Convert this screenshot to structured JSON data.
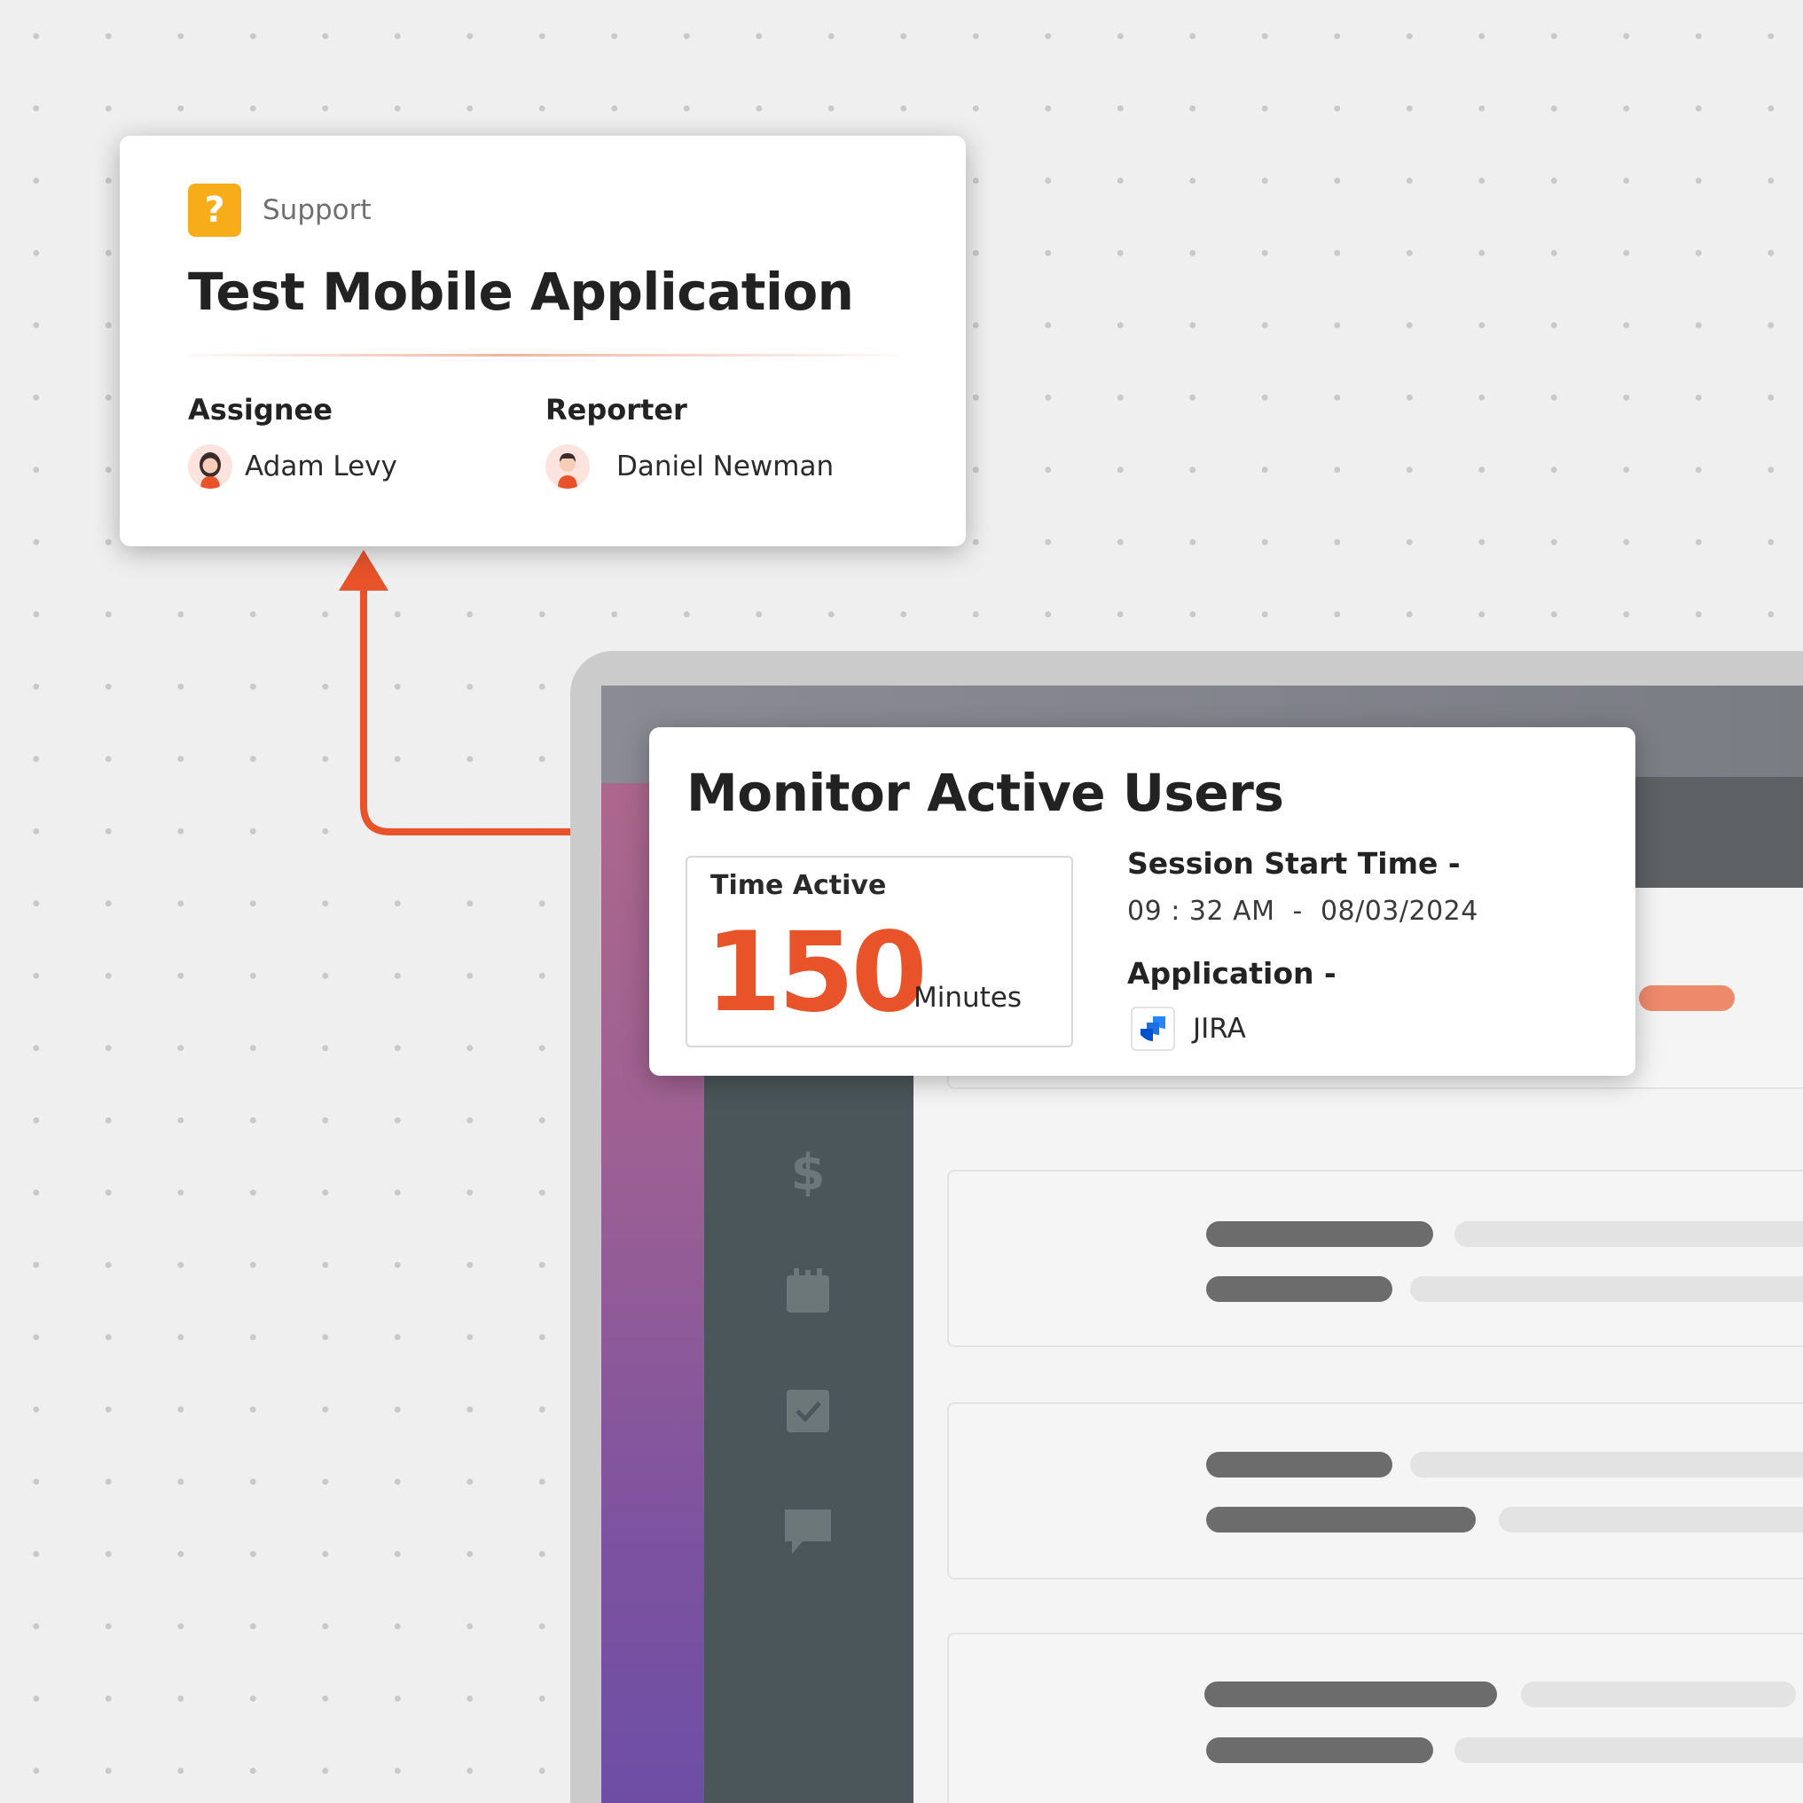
{
  "ticket": {
    "category": "Support",
    "category_icon": "question-icon",
    "title": "Test Mobile Application",
    "assignee_label": "Assignee",
    "assignee_name": "Adam Levy",
    "reporter_label": "Reporter",
    "reporter_name": "Daniel Newman"
  },
  "monitor": {
    "title": "Monitor Active Users",
    "time_active_label": "Time Active",
    "time_active_value": "150",
    "time_active_unit": "Minutes",
    "session_start_label": "Session Start Time -",
    "session_start_value": "09 : 32 AM  -  08/03/2024",
    "application_label": "Application -",
    "application_name": "JIRA"
  },
  "sidebar_icons": [
    "support-icon",
    "user-icon",
    "dollar-icon",
    "calendar-icon",
    "checkbox-icon",
    "chat-icon"
  ],
  "colors": {
    "accent": "#e8532a",
    "support_tag": "#f7ac19",
    "sidebar": "#4a5659",
    "jira_blue": "#2684ff"
  }
}
